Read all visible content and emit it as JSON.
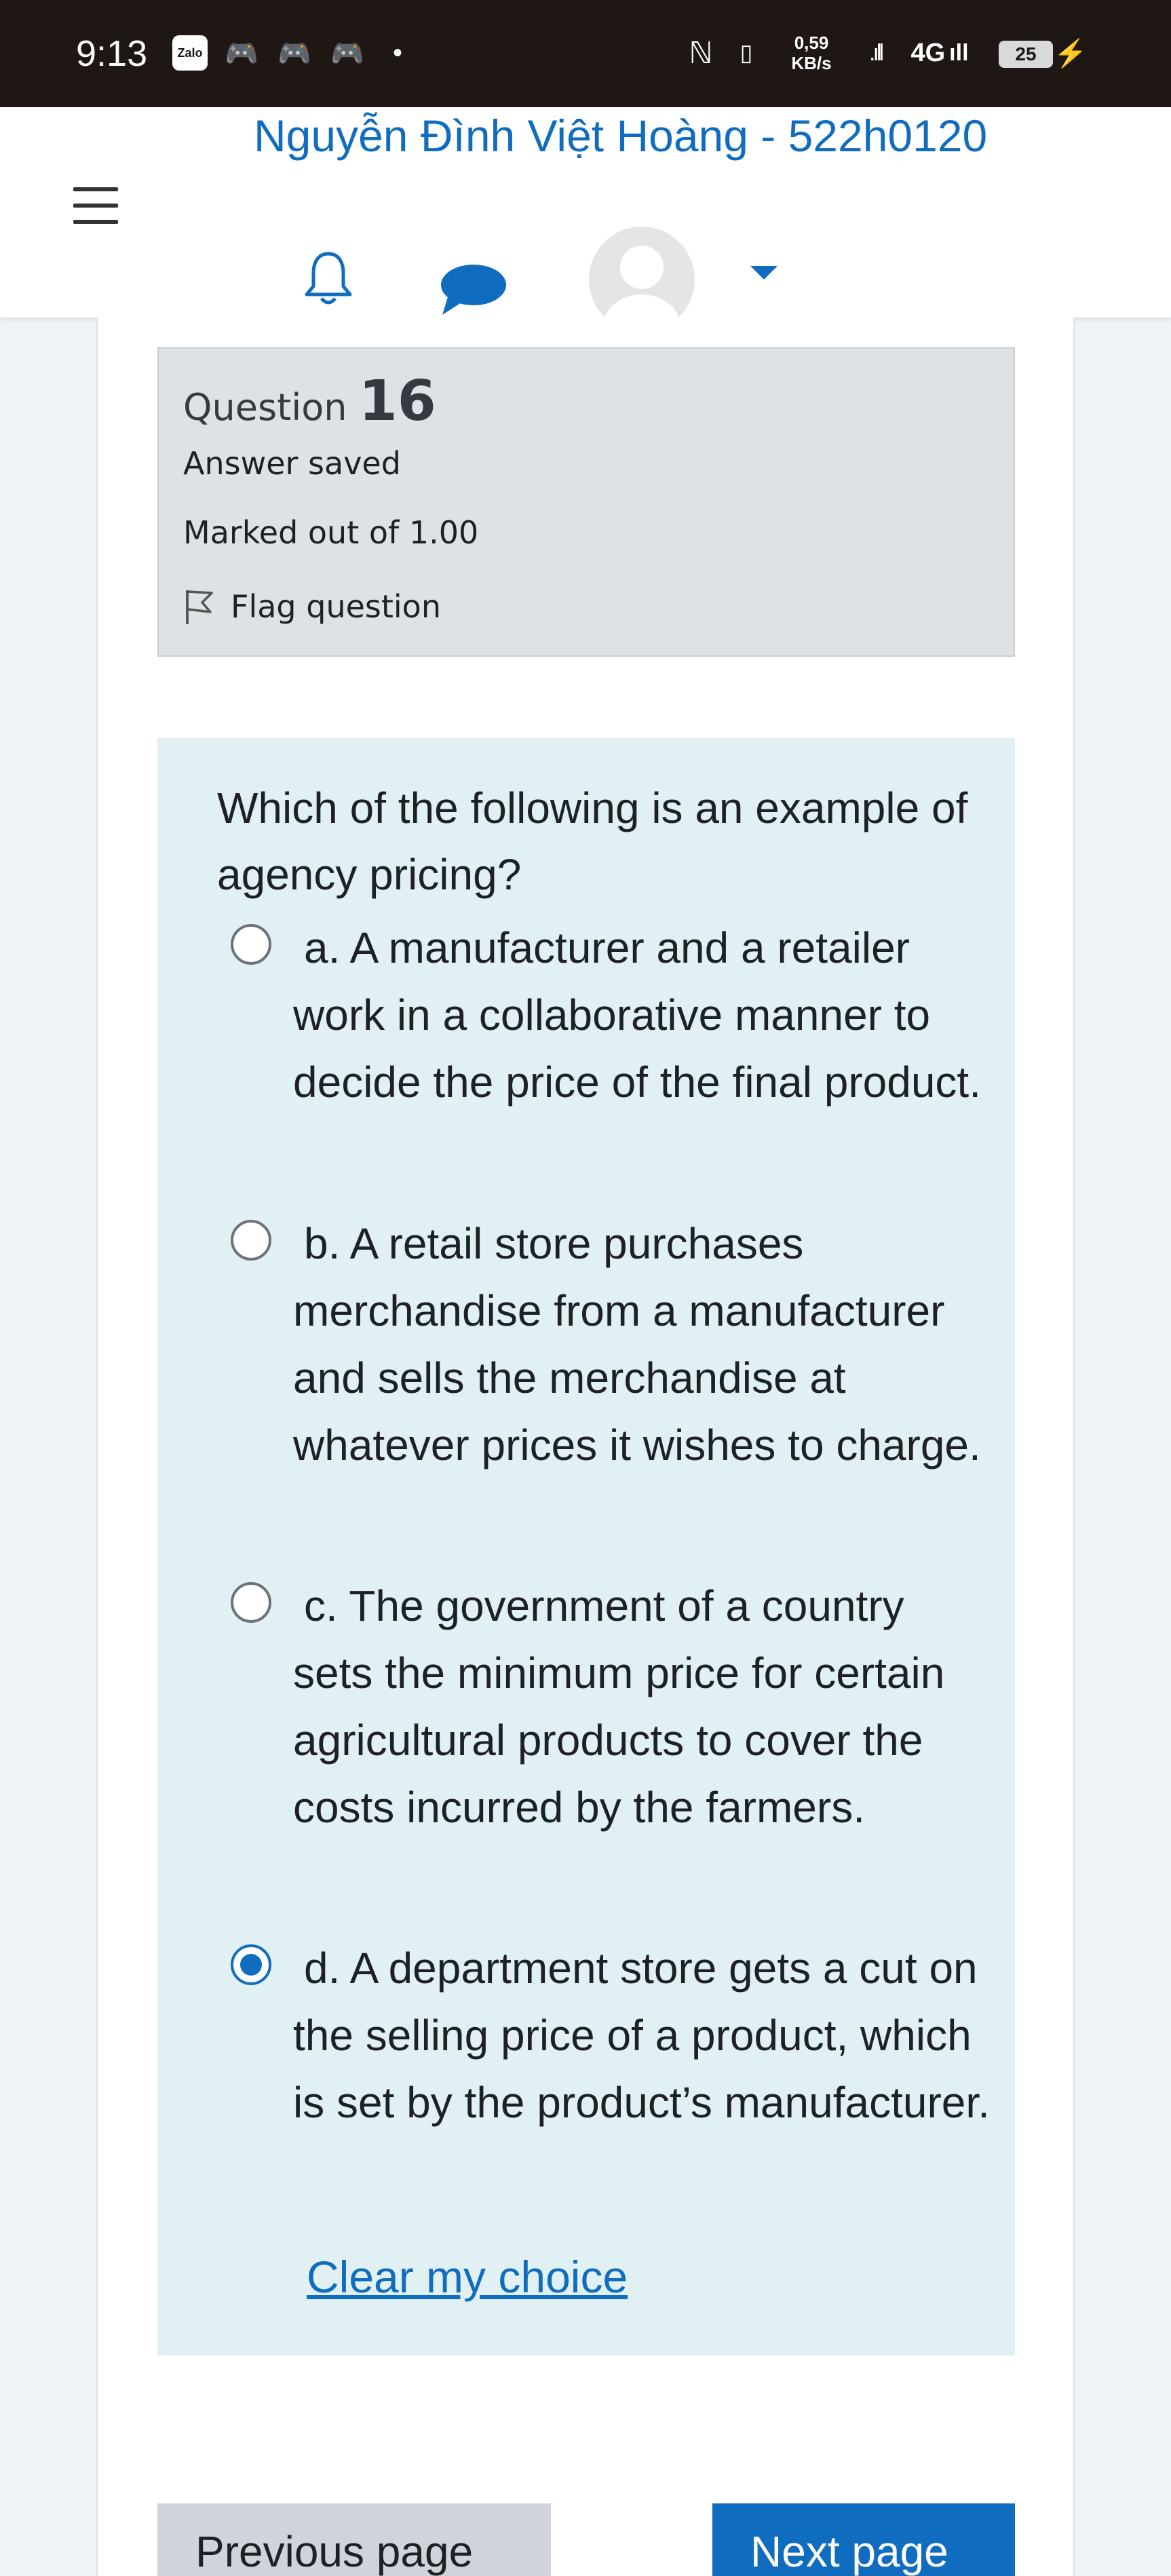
{
  "status_bar": {
    "time": "9:13",
    "zalo_label": "Zalo",
    "net_speed_value": "0,59",
    "net_speed_unit": "KB/s",
    "network_type": "4G",
    "battery_level": "25"
  },
  "header": {
    "user_name": "Nguyễn Đình Việt Hoàng - 522h0120"
  },
  "question_info": {
    "question_word": "Question",
    "number": "16",
    "state": "Answer saved",
    "grade": "Marked out of 1.00",
    "flag_label": "Flag question"
  },
  "question": {
    "text": "Which of the following is an example of agency pricing?",
    "options": [
      {
        "label": "a. A manufacturer and a retailer work in a collaborative manner to decide the price of the final product.",
        "selected": false
      },
      {
        "label": "b. A retail store purchases merchandise from a manufacturer and sells the merchandise at whatever prices it wishes to charge.",
        "selected": false
      },
      {
        "label": "c. The government of a country sets the minimum price for certain agricultural products to cover the costs incurred by the farmers.",
        "selected": false
      },
      {
        "label": "d. A department store gets a cut on the selling price of a product, which is set by the product’s manufacturer.",
        "selected": true
      }
    ],
    "clear_label": "Clear my choice"
  },
  "navigation": {
    "previous_label": "Previous page",
    "next_label": "Next page"
  },
  "colors": {
    "accent": "#0f6cbf",
    "content_bg": "#e0f0f3",
    "info_bg": "#dee2e6"
  }
}
